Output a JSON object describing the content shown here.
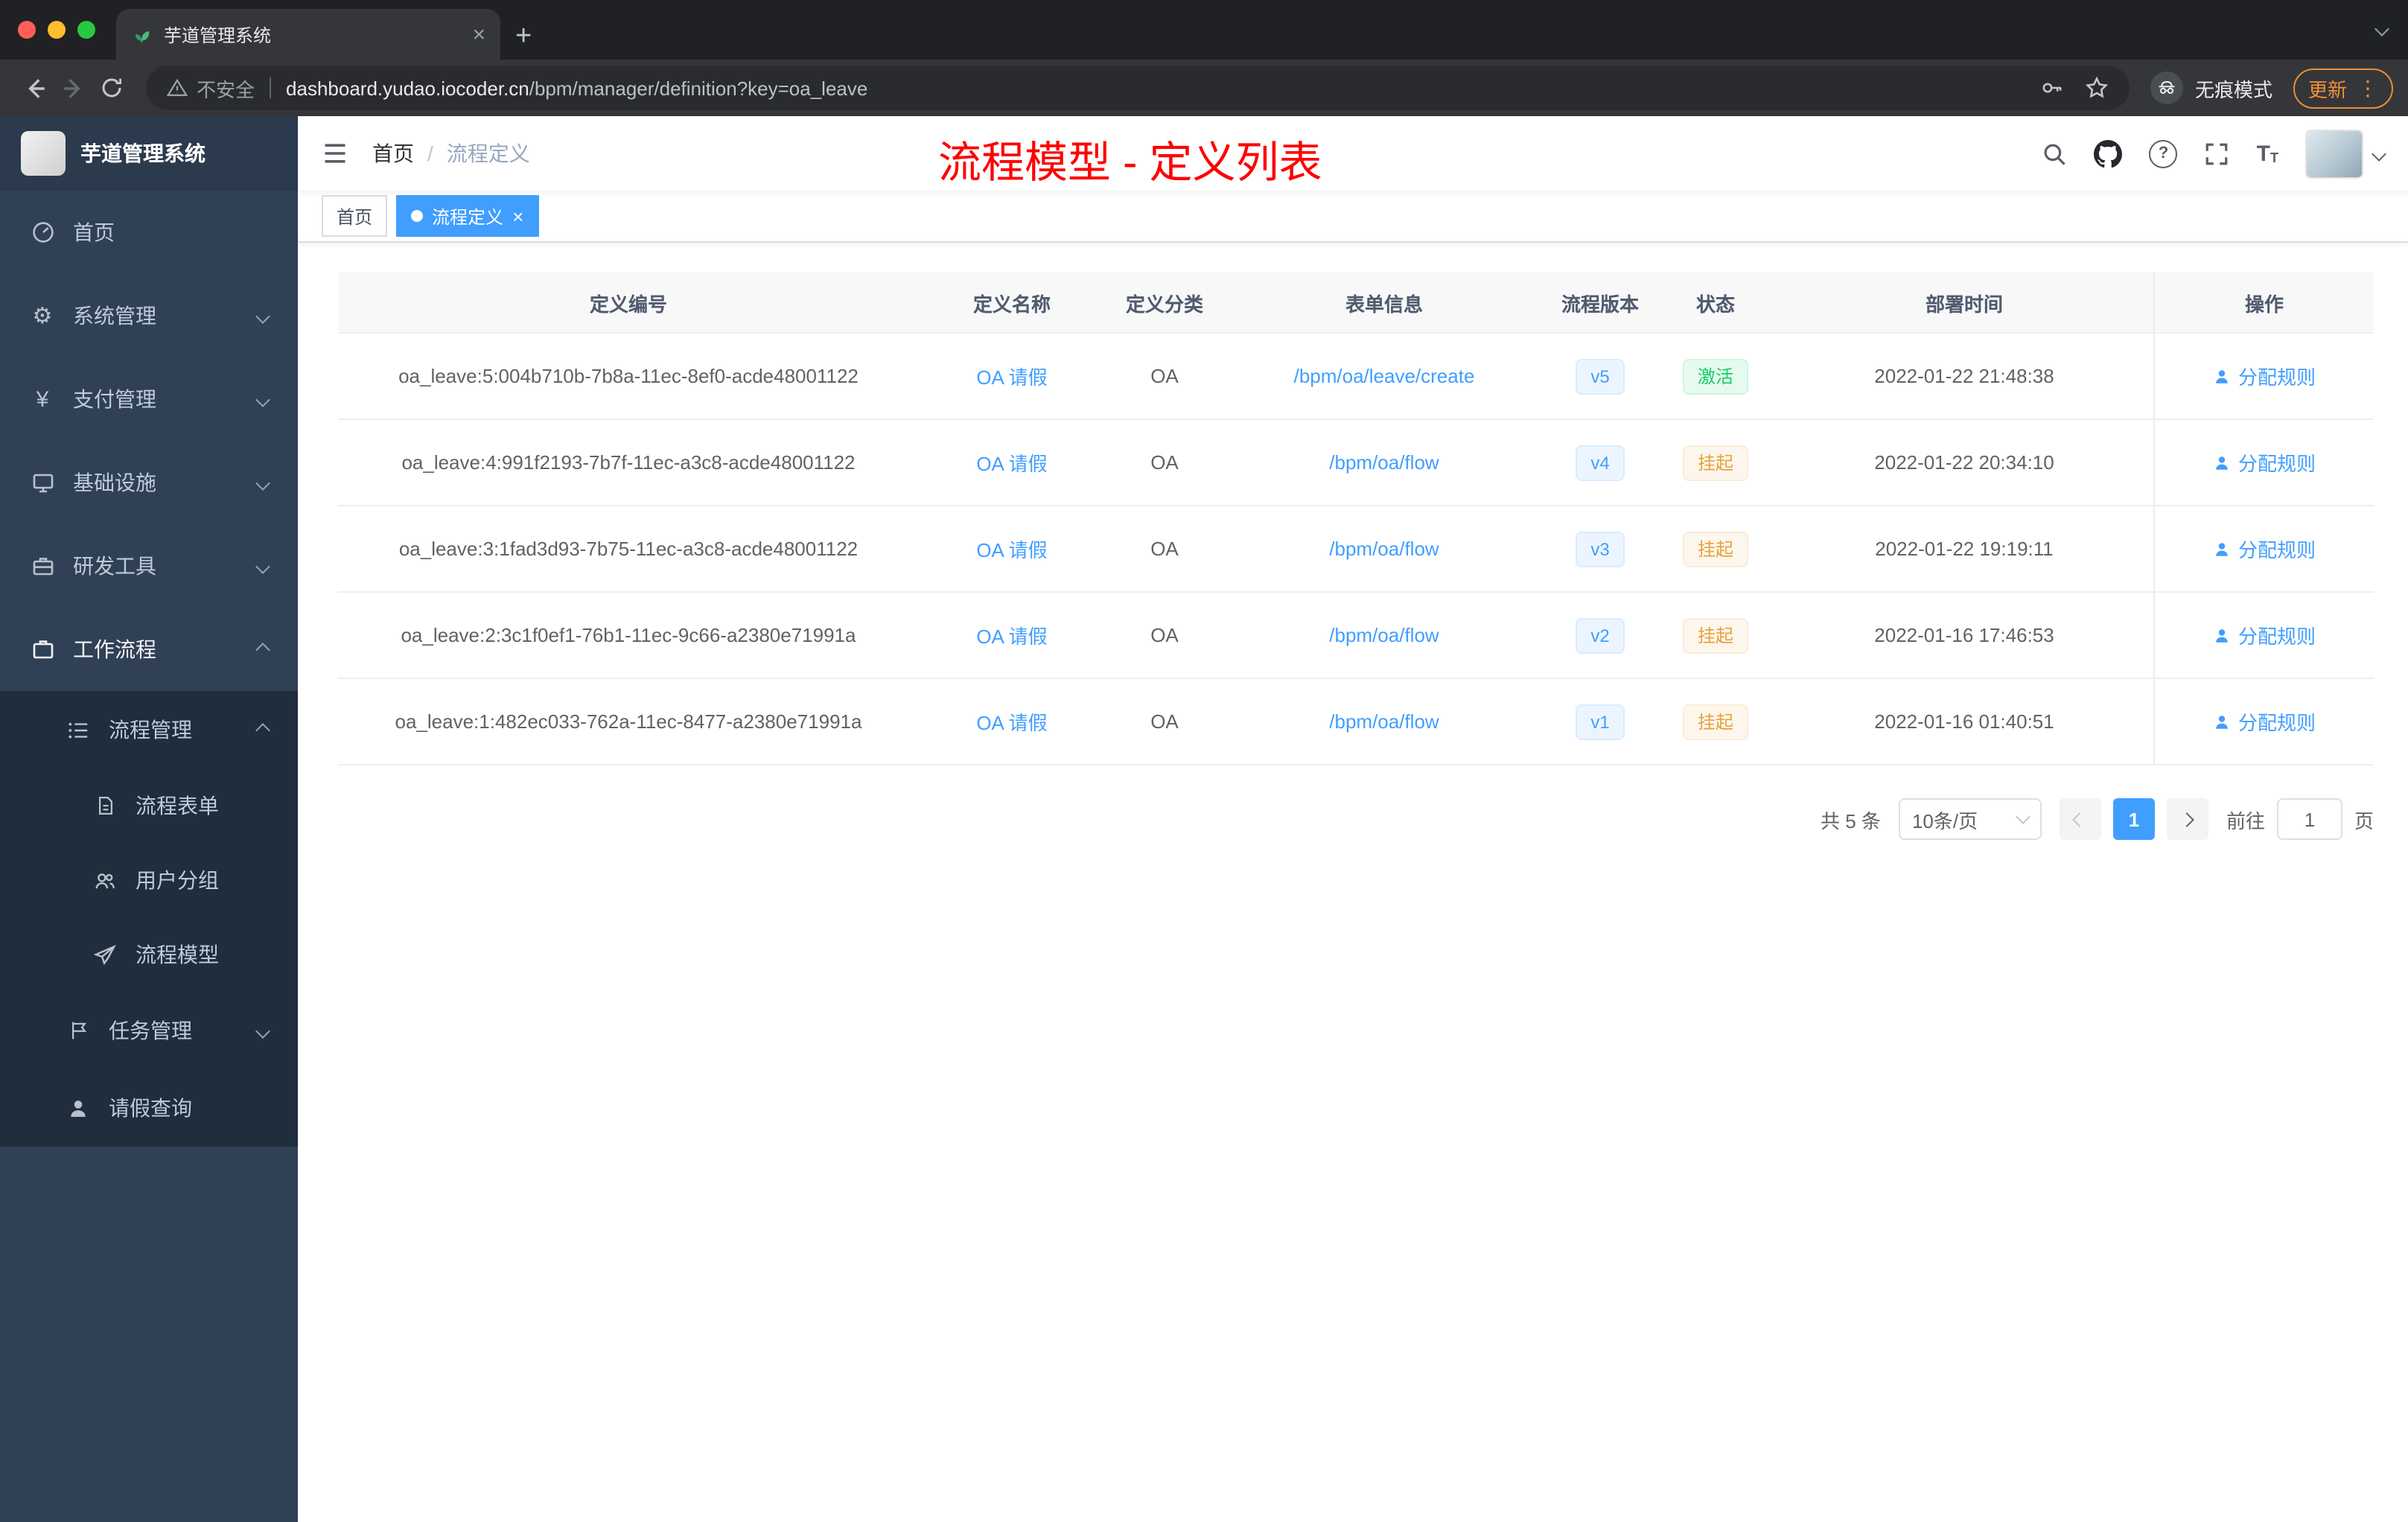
{
  "browser": {
    "tab_title": "芋道管理系统",
    "security_label": "不安全",
    "url_host": "dashboard.yudao.iocoder.cn",
    "url_path": "/bpm/manager/definition?key=oa_leave",
    "incognito_label": "无痕模式",
    "update_label": "更新"
  },
  "sidebar": {
    "logo_title": "芋道管理系统",
    "menu": [
      {
        "label": "首页"
      },
      {
        "label": "系统管理"
      },
      {
        "label": "支付管理"
      },
      {
        "label": "基础设施"
      },
      {
        "label": "研发工具"
      },
      {
        "label": "工作流程"
      }
    ],
    "workflow": {
      "process_mgmt": "流程管理",
      "process_children": [
        "流程表单",
        "用户分组",
        "流程模型"
      ],
      "task_mgmt": "任务管理",
      "leave_query": "请假查询"
    }
  },
  "navbar": {
    "breadcrumb_home": "首页",
    "breadcrumb_current": "流程定义",
    "annotation": "流程模型 - 定义列表"
  },
  "tags": {
    "home": "首页",
    "active": "流程定义"
  },
  "table": {
    "headers": [
      "定义编号",
      "定义名称",
      "定义分类",
      "表单信息",
      "流程版本",
      "状态",
      "部署时间",
      "操作"
    ],
    "action_label": "分配规则",
    "rows": [
      {
        "id": "oa_leave:5:004b710b-7b8a-11ec-8ef0-acde48001122",
        "name": "OA 请假",
        "category": "OA",
        "form": "/bpm/oa/leave/create",
        "version": "v5",
        "status": "激活",
        "deploy_time": "2022-01-22 21:48:38"
      },
      {
        "id": "oa_leave:4:991f2193-7b7f-11ec-a3c8-acde48001122",
        "name": "OA 请假",
        "category": "OA",
        "form": "/bpm/oa/flow",
        "version": "v4",
        "status": "挂起",
        "deploy_time": "2022-01-22 20:34:10"
      },
      {
        "id": "oa_leave:3:1fad3d93-7b75-11ec-a3c8-acde48001122",
        "name": "OA 请假",
        "category": "OA",
        "form": "/bpm/oa/flow",
        "version": "v3",
        "status": "挂起",
        "deploy_time": "2022-01-22 19:19:11"
      },
      {
        "id": "oa_leave:2:3c1f0ef1-76b1-11ec-9c66-a2380e71991a",
        "name": "OA 请假",
        "category": "OA",
        "form": "/bpm/oa/flow",
        "version": "v2",
        "status": "挂起",
        "deploy_time": "2022-01-16 17:46:53"
      },
      {
        "id": "oa_leave:1:482ec033-762a-11ec-8477-a2380e71991a",
        "name": "OA 请假",
        "category": "OA",
        "form": "/bpm/oa/flow",
        "version": "v1",
        "status": "挂起",
        "deploy_time": "2022-01-16 01:40:51"
      }
    ]
  },
  "pagination": {
    "total": "共 5 条",
    "page_size": "10条/页",
    "page": "1",
    "goto_label": "前往",
    "goto_value": "1",
    "page_unit": "页"
  },
  "colors": {
    "accent": "#409eff",
    "annotation_red": "#fe0000",
    "sidebar_bg": "#304156",
    "submenu_bg": "#1f2d3d",
    "success": "#13ce66",
    "warning": "#e6a23c",
    "version_tag": "#409eff"
  }
}
